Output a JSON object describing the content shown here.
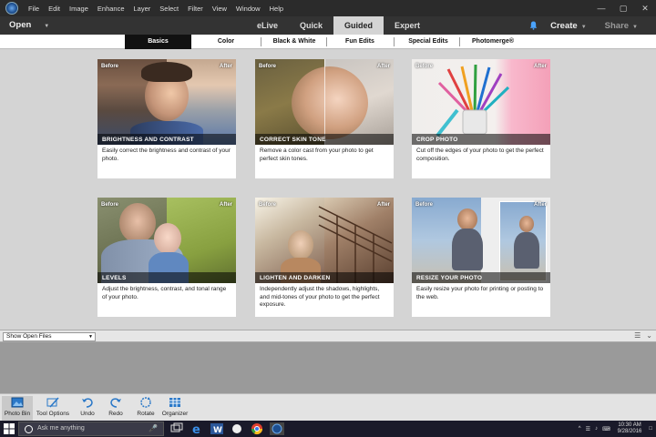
{
  "menu": {
    "items": [
      "File",
      "Edit",
      "Image",
      "Enhance",
      "Layer",
      "Select",
      "Filter",
      "View",
      "Window",
      "Help"
    ]
  },
  "modebar": {
    "open_label": "Open",
    "modes": [
      "eLive",
      "Quick",
      "Guided",
      "Expert"
    ],
    "active_mode": "Guided",
    "create_label": "Create",
    "share_label": "Share"
  },
  "subtabs": [
    "Basics",
    "Color",
    "Black & White",
    "Fun Edits",
    "Special Edits",
    "Photomerge®"
  ],
  "cards": [
    {
      "title": "BRIGHTNESS AND CONTRAST",
      "before": "Before",
      "after": "After",
      "desc": "Easily correct the brightness and contrast of your photo."
    },
    {
      "title": "CORRECT SKIN TONE",
      "before": "Before",
      "after": "After",
      "desc": "Remove a color cast from your photo to get perfect skin tones."
    },
    {
      "title": "CROP PHOTO",
      "before": "Before",
      "after": "After",
      "desc": "Cut off the edges of your photo to get the perfect composition."
    },
    {
      "title": "LEVELS",
      "before": "Before",
      "after": "After",
      "desc": "Adjust the brightness, contrast, and tonal range of your photo."
    },
    {
      "title": "LIGHTEN AND DARKEN",
      "before": "Before",
      "after": "After",
      "desc": "Independently adjust the shadows, highlights, and mid-tones of your photo to get the perfect exposure."
    },
    {
      "title": "RESIZE YOUR PHOTO",
      "before": "Before",
      "after": "After",
      "desc": "Easily resize your photo for printing or posting to the web."
    }
  ],
  "bin": {
    "select_value": "Show Open Files"
  },
  "toolbar": {
    "photo_bin": "Photo Bin",
    "tool_options": "Tool Options",
    "undo": "Undo",
    "redo": "Redo",
    "rotate": "Rotate",
    "organizer": "Organizer"
  },
  "taskbar": {
    "search_placeholder": "Ask me anything",
    "time": "10:30 AM",
    "date": "9/28/2016"
  },
  "colors": {
    "accent": "#4aa3ff",
    "menubar": "#2b2b2b",
    "modebar": "#333333",
    "taskbar": "#1a1a2a"
  }
}
